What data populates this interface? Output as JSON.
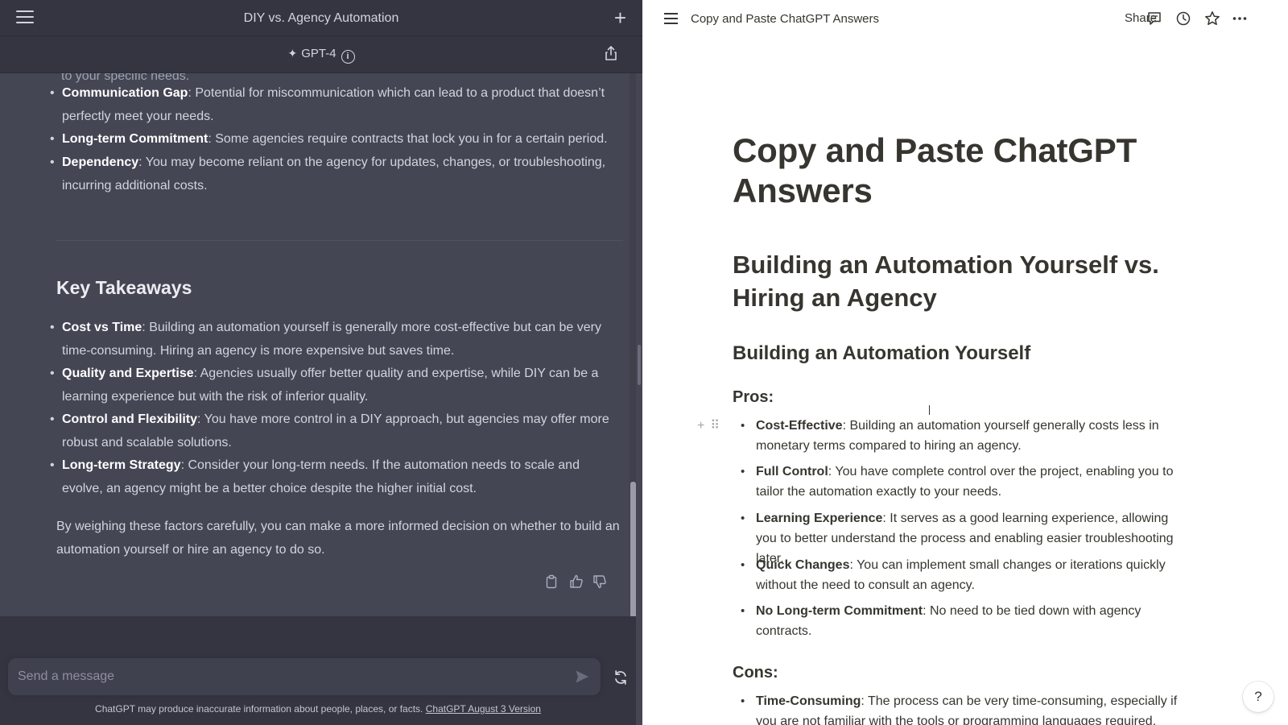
{
  "chatgpt": {
    "title": "DIY vs. Agency Automation",
    "model": "GPT-4",
    "cut_line": "to your specific needs.",
    "agency_cons": [
      {
        "term": "Communication Gap",
        "text": ": Potential for miscommunication which can lead to a product that doesn’t perfectly meet your needs."
      },
      {
        "term": "Long-term Commitment",
        "text": ": Some agencies require contracts that lock you in for a certain period."
      },
      {
        "term": "Dependency",
        "text": ": You may become reliant on the agency for updates, changes, or troubleshooting, incurring additional costs."
      }
    ],
    "key_takeaways_heading": "Key Takeaways",
    "takeaways": [
      {
        "term": "Cost vs Time",
        "text": ": Building an automation yourself is generally more cost-effective but can be very time-consuming. Hiring an agency is more expensive but saves time."
      },
      {
        "term": "Quality and Expertise",
        "text": ": Agencies usually offer better quality and expertise, while DIY can be a learning experience but with the risk of inferior quality."
      },
      {
        "term": "Control and Flexibility",
        "text": ": You have more control in a DIY approach, but agencies may offer more robust and scalable solutions."
      },
      {
        "term": "Long-term Strategy",
        "text": ": Consider your long-term needs. If the automation needs to scale and evolve, an agency might be a better choice despite the higher initial cost."
      }
    ],
    "conclusion": "By weighing these factors carefully, you can make a more informed decision on whether to build an automation yourself or hire an agency to do so.",
    "composer_placeholder": "Send a message",
    "disclaimer": "ChatGPT may produce inaccurate information about people, places, or facts.",
    "version_link": "ChatGPT August 3 Version",
    "colors": {
      "panel": "#444654",
      "topbar": "#343541",
      "text": "#d1d5db"
    }
  },
  "notion": {
    "breadcrumb": "Copy and Paste ChatGPT Answers",
    "share": "Share",
    "title": "Copy and Paste ChatGPT Answers",
    "h1": "Building an Automation Yourself vs. Hiring an Agency",
    "h2": "Building an Automation Yourself",
    "pros_heading": "Pros:",
    "pros": [
      {
        "term": "Cost-Effective",
        "text": ": Building an automation yourself generally costs less in monetary terms compared to hiring an agency."
      },
      {
        "term": "Full Control",
        "text": ": You have complete control over the project, enabling you to tailor the automation exactly to your needs."
      },
      {
        "term": "Learning Experience",
        "text": ": It serves as a good learning experience, allowing you to better understand the process and enabling easier troubleshooting later."
      },
      {
        "term": "Quick Changes",
        "text": ": You can implement small changes or iterations quickly without the need to consult an agency."
      },
      {
        "term": "No Long-term Commitment",
        "text": ": No need to be tied down with agency contracts."
      }
    ],
    "cons_heading": "Cons:",
    "cons": [
      {
        "term": "Time-Consuming",
        "text": ": The process can be very time-consuming, especially if you are not familiar with the tools or programming languages required."
      }
    ],
    "help": "?"
  }
}
